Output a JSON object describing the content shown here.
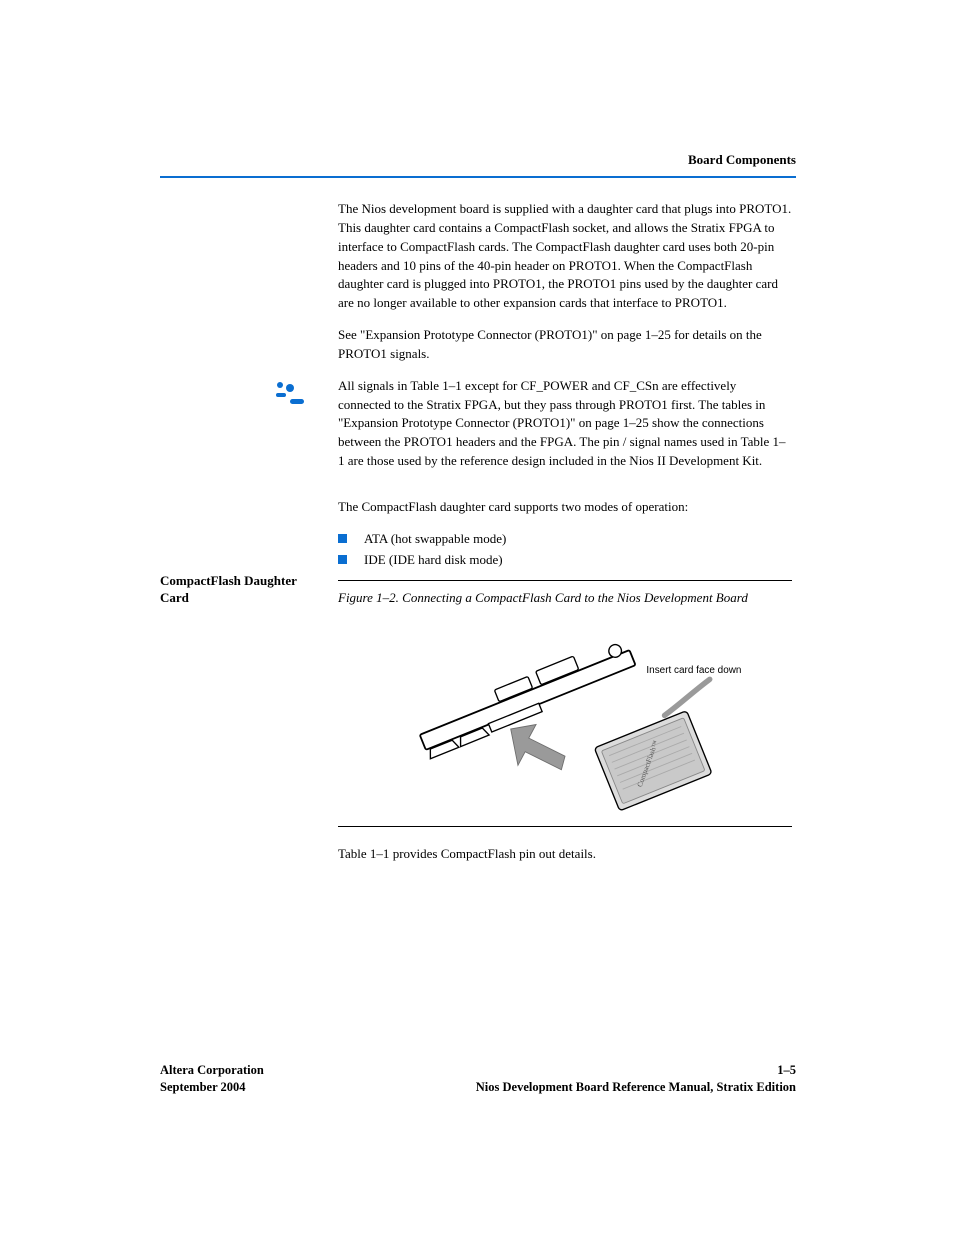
{
  "header": {
    "section": "Board Components"
  },
  "body": {
    "p1": "The Nios development board is supplied with a daughter card that plugs into PROTO1. This daughter card contains a CompactFlash socket, and allows the Stratix FPGA to interface to CompactFlash cards. The CompactFlash daughter card uses both 20-pin headers and 10 pins of the 40-pin header on PROTO1. When the CompactFlash daughter card is plugged into PROTO1, the PROTO1 pins used by the daughter card are no longer available to other expansion cards that interface to PROTO1.",
    "p2_prefix": "See ",
    "p2_link": "\"Expansion Prototype Connector (PROTO1)\" on page 1–25",
    "p2_suffix": " for details on the PROTO1 signals.",
    "note_prefix": "All signals in ",
    "note_link": "Table 1–1",
    "note_suffix": " except for CF_POWER and CF_CSn are effectively connected to the Stratix FPGA, but they pass through PROTO1 first. The tables in ",
    "note_link2": "\"Expansion Prototype Connector (PROTO1)\" on page 1–25",
    "note_suffix2": " show the connections between the PROTO1 headers and the FPGA. The pin / signal names used in ",
    "note_link3": "Table 1–1",
    "note_suffix3": " are those used by the reference design included in the Nios II Development Kit.",
    "p3": "The CompactFlash daughter card supports two modes of operation:",
    "bullet1": "ATA (hot swappable mode)",
    "bullet2": "IDE (IDE hard disk mode)",
    "fig_caption_strong": "Figure 1–2.",
    "fig_caption_rest": "Connecting a CompactFlash Card to the Nios Development Board",
    "fig_label": "Insert card face down",
    "after_fig_prefix": "Table 1–1",
    "after_fig_rest": " provides CompactFlash pin out details."
  },
  "side": {
    "compactflash": "CompactFlash Daughter Card"
  },
  "footer": {
    "left1": "Altera Corporation",
    "left2": "September 2004",
    "right1": "1–5",
    "right2": "Nios Development Board Reference Manual, Stratix Edition"
  }
}
